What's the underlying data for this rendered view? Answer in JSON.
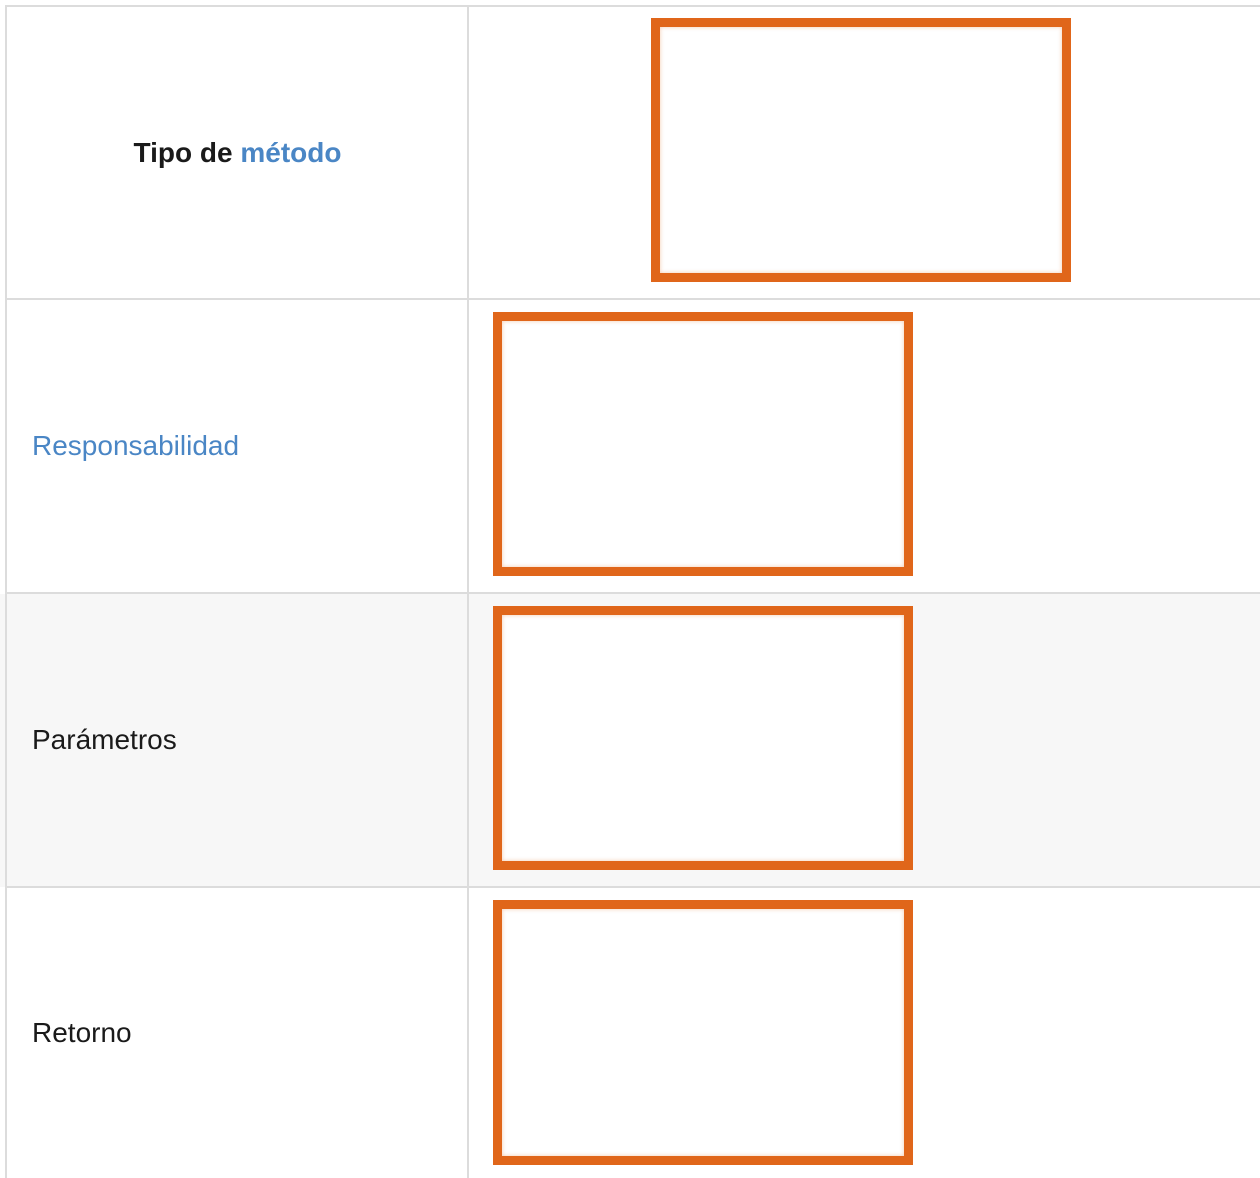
{
  "rows": [
    {
      "label_prefix": "Tipo de",
      "label_link": "método",
      "image": "orange-outlined-rectangle"
    },
    {
      "label": "Responsabilidad",
      "label_style": "link",
      "image": "orange-outlined-rectangle"
    },
    {
      "label": "Parámetros",
      "image": "orange-outlined-rectangle"
    },
    {
      "label": "Retorno",
      "image": "orange-outlined-rectangle"
    }
  ],
  "colors": {
    "border": "#dcdcdc",
    "shaded_row": "#f7f7f7",
    "link": "#4a86c5",
    "box_outline": "#e0661a",
    "text": "#1a1a1a"
  }
}
